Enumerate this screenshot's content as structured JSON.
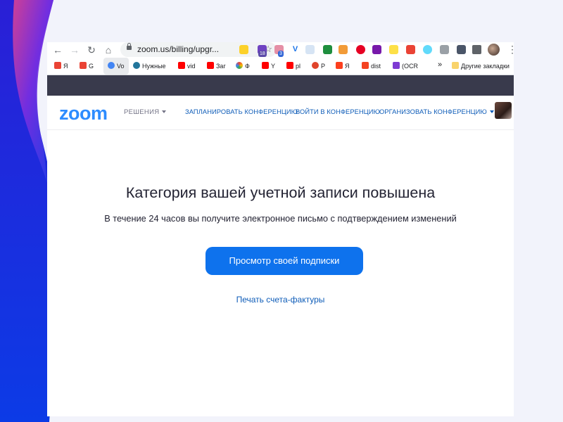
{
  "browser": {
    "url": "zoom.us/billing/upgr...",
    "bookmarks": [
      {
        "label": "Я",
        "icon": "gmail-icon",
        "color": "#ea4335"
      },
      {
        "label": "G",
        "icon": "gmail-m-icon",
        "color": "#ea4335"
      },
      {
        "label": "Vo",
        "icon": "microphone-icon",
        "color": "#4285f4"
      },
      {
        "label": "Нужные",
        "icon": "wordpress-icon",
        "color": "#21759b"
      },
      {
        "label": "vid",
        "icon": "youtube-icon",
        "color": "#ff0000"
      },
      {
        "label": "Заг",
        "icon": "youtube-icon",
        "color": "#ff0000"
      },
      {
        "label": "Ф",
        "icon": "google-photos-icon",
        "color": "#fbbc04"
      },
      {
        "label": "Y",
        "icon": "youtube-icon",
        "color": "#ff0000"
      },
      {
        "label": "pl",
        "icon": "youtube-icon",
        "color": "#ff0000"
      },
      {
        "label": "P",
        "icon": "tomato-icon",
        "color": "#e0442b"
      },
      {
        "label": "Я",
        "icon": "yandex-icon",
        "color": "#fc3f1d"
      },
      {
        "label": "dist",
        "icon": "joomla-icon",
        "color": "#f44321"
      },
      {
        "label": "(OCR",
        "icon": "jpg-icon",
        "color": "#7e3bd3"
      }
    ],
    "overflow": "»",
    "other_bookmarks": "Другие закладки"
  },
  "header": {
    "logo": "zoom",
    "solutions": "РЕШЕНИЯ",
    "nav": {
      "schedule": "ЗАПЛАНИРОВАТЬ КОНФЕРЕНЦИЮ",
      "join": "ВОЙТИ В КОНФЕРЕНЦИЮ",
      "host": "ОРГАНИЗОВАТЬ КОНФЕРЕНЦИЮ"
    }
  },
  "main": {
    "title": "Категория вашей учетной записи повышена",
    "subtitle": "В течение 24 часов вы получите электронное письмо с подтверждением изменений",
    "button": "Просмотр своей подписки",
    "link": "Печать счета-фактуры"
  },
  "colors": {
    "brand_blue": "#2d8cff",
    "button_blue": "#0e72ed",
    "link_blue": "#0e5cb8",
    "dark_band": "#393a4c"
  }
}
